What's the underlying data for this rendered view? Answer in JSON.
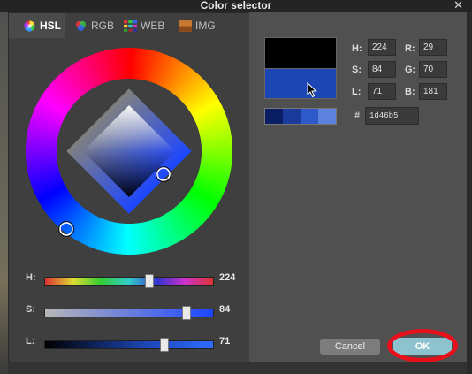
{
  "window": {
    "title": "Color selector",
    "close_glyph": "✕"
  },
  "tabs": [
    {
      "label": "HSL",
      "icon": "hsl-wheel-icon",
      "active": true
    },
    {
      "label": "RGB",
      "icon": "rgb-circles-icon",
      "active": false
    },
    {
      "label": "WEB",
      "icon": "web-grid-icon",
      "active": false
    },
    {
      "label": "IMG",
      "icon": "image-icon",
      "active": false
    }
  ],
  "sliders": {
    "h": {
      "label": "H:",
      "value": "224",
      "fraction": 0.62
    },
    "s": {
      "label": "S:",
      "value": "84",
      "fraction": 0.84
    },
    "l": {
      "label": "L:",
      "value": "71",
      "fraction": 0.71
    }
  },
  "fields": {
    "h": {
      "label": "H:",
      "value": "224"
    },
    "s": {
      "label": "S:",
      "value": "84"
    },
    "l": {
      "label": "L:",
      "value": "71"
    },
    "r": {
      "label": "R:",
      "value": "29"
    },
    "g": {
      "label": "G:",
      "value": "70"
    },
    "b": {
      "label": "B:",
      "value": "181"
    }
  },
  "hex": {
    "symbol": "#",
    "value": "1d46b5"
  },
  "colors": {
    "previous": "#000000",
    "current": "#1d46b5",
    "palette": [
      "#0a1f63",
      "#1a3a9c",
      "#2e5ac9",
      "#5b82dc"
    ]
  },
  "buttons": {
    "cancel": "Cancel",
    "ok": "OK"
  }
}
